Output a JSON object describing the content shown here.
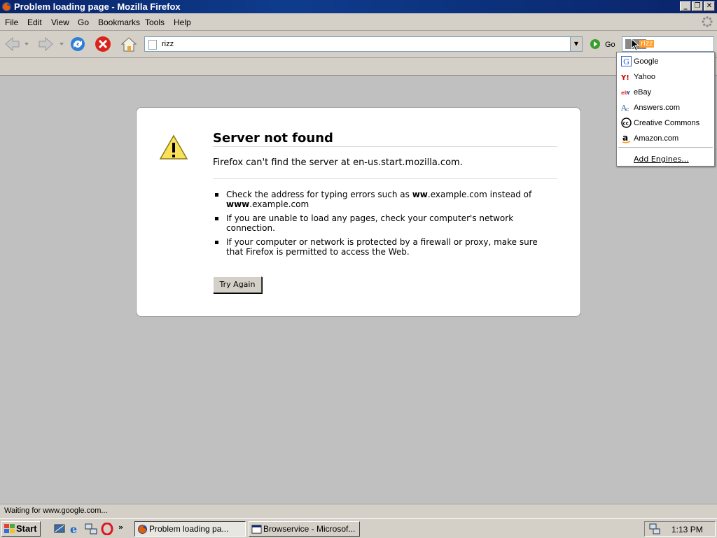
{
  "window": {
    "title": "Problem loading page - Mozilla Firefox",
    "controls": [
      "_",
      "❐",
      "✕"
    ]
  },
  "menu": {
    "items": [
      "File",
      "Edit",
      "View",
      "Go",
      "Bookmarks",
      "Tools",
      "Help"
    ]
  },
  "toolbar": {
    "url": "rizz",
    "go_label": "Go",
    "search_text": "rizz"
  },
  "error": {
    "title": "Server not found",
    "description": "Firefox can't find the server at en-us.start.mozilla.com.",
    "bullets": [
      {
        "pre": "Check the address for typing errors such as ",
        "b1": "ww",
        "mid": ".example.com instead of ",
        "b2": "www",
        "post": ".example.com"
      },
      {
        "text": "If you are unable to load any pages, check your computer's network connection."
      },
      {
        "text": "If your computer or network is protected by a firewall or proxy, make sure that Firefox is permitted to access the Web."
      }
    ],
    "button": "Try Again"
  },
  "search_engines": {
    "items": [
      {
        "label": "Google",
        "icon": "google-icon",
        "color": "#3366cc"
      },
      {
        "label": "Yahoo",
        "icon": "yahoo-icon",
        "color": "#cc0000"
      },
      {
        "label": "eBay",
        "icon": "ebay-icon",
        "color": "#e53238"
      },
      {
        "label": "Answers.com",
        "icon": "answers-icon",
        "color": "#336699"
      },
      {
        "label": "Creative Commons",
        "icon": "creative-commons-icon",
        "color": "#000000"
      },
      {
        "label": "Amazon.com",
        "icon": "amazon-icon",
        "color": "#000000"
      }
    ],
    "add": "Add Engines..."
  },
  "status": {
    "text": "Waiting for www.google.com..."
  },
  "taskbar": {
    "start": "Start",
    "windows": [
      {
        "label": "Problem loading pa...",
        "active": true
      },
      {
        "label": "Browservice - Microsof...",
        "active": false
      }
    ],
    "clock": "1:13 PM"
  }
}
